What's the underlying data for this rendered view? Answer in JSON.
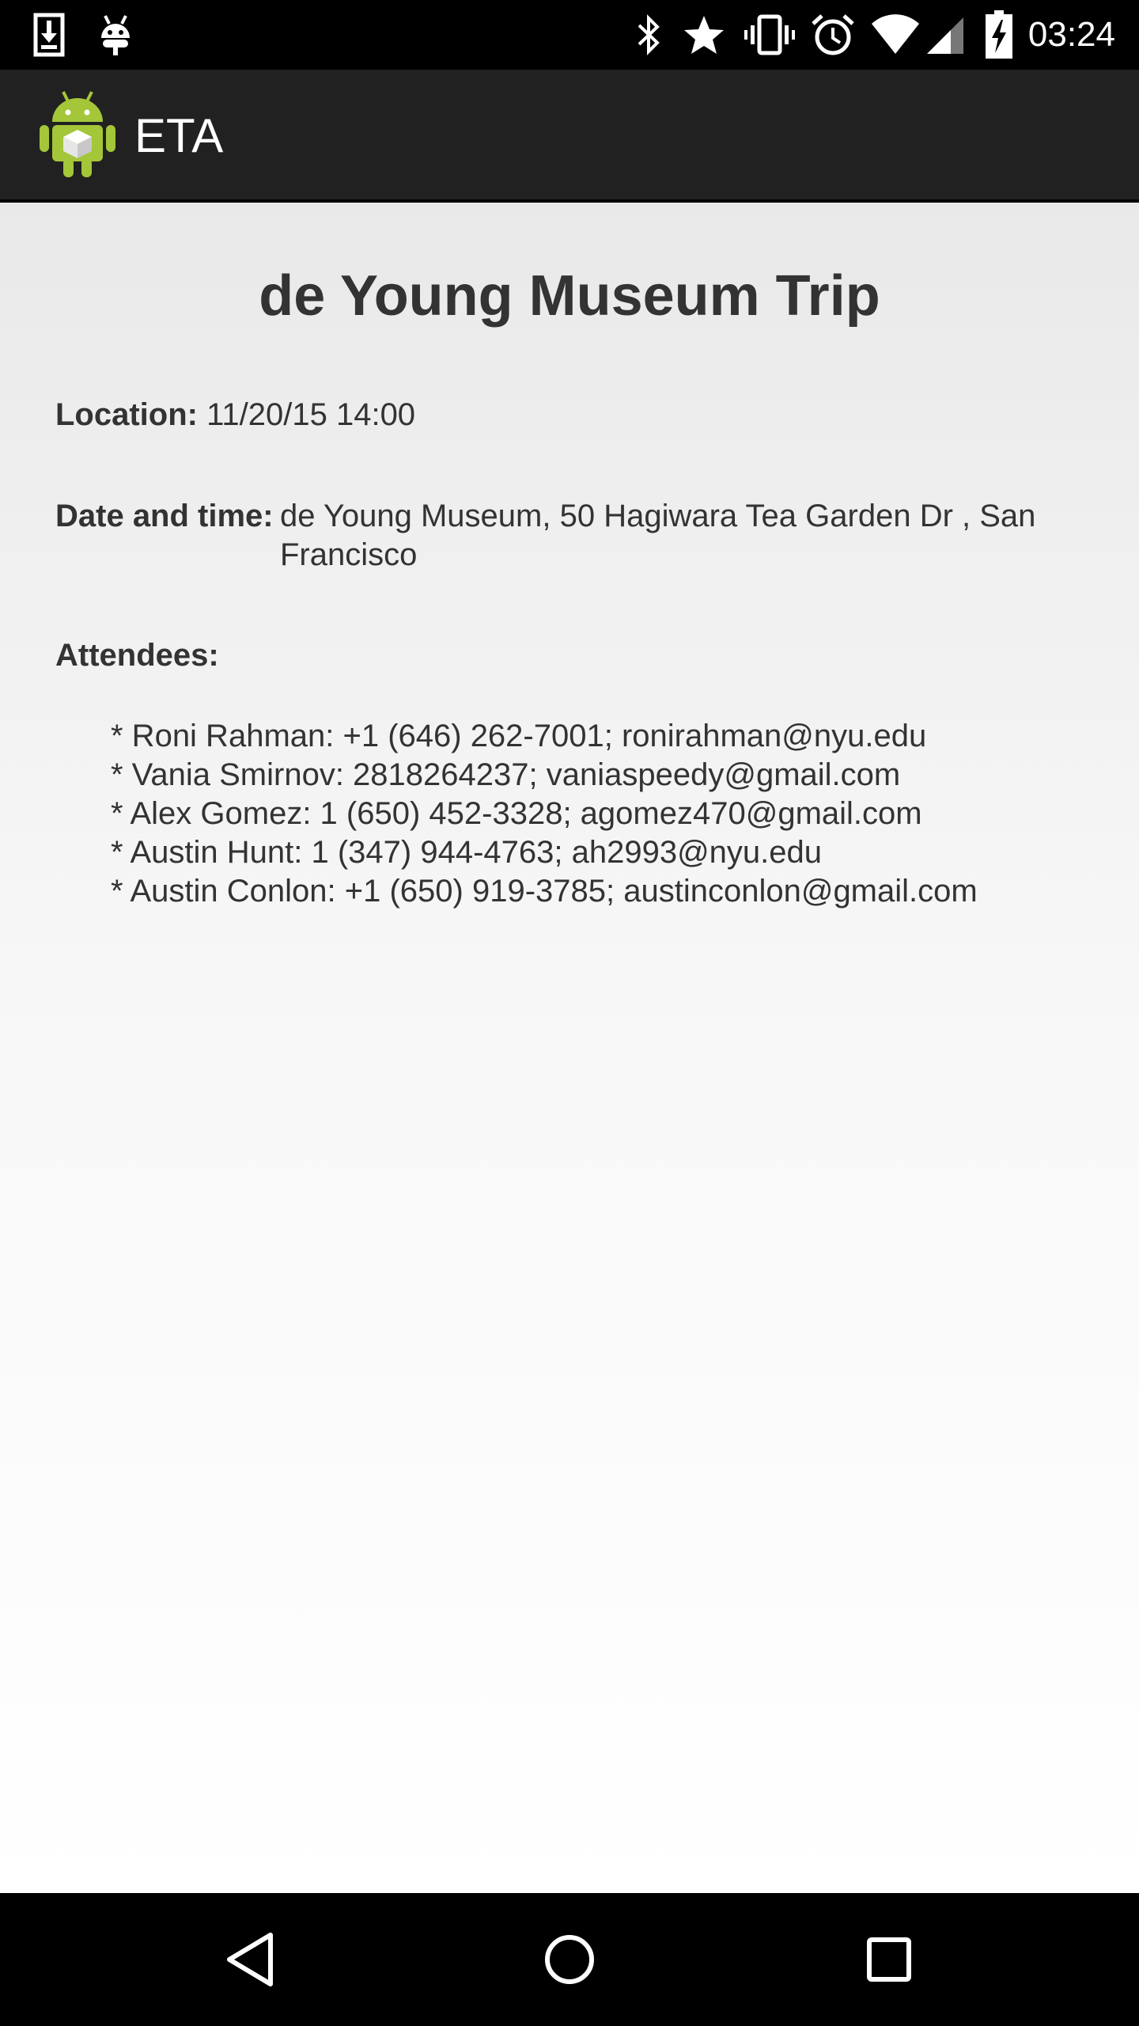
{
  "status_bar": {
    "time": "03:24",
    "icons": [
      "download-icon",
      "android-debug-icon",
      "bluetooth-icon",
      "star-icon",
      "vibrate-icon",
      "alarm-icon",
      "wifi-icon",
      "cell-signal-icon",
      "battery-charging-icon"
    ]
  },
  "action_bar": {
    "title": "ETA",
    "app_icon": "android-app-icon"
  },
  "event": {
    "title": "de Young Museum Trip",
    "location_label": "Location:",
    "location_value": "11/20/15 14:00",
    "datetime_label": "Date and time:",
    "datetime_value": "de Young Museum, 50 Hagiwara Tea Garden Dr , San Francisco",
    "attendees_label": "Attendees:",
    "attendees": [
      "* Roni Rahman: +1 (646) 262-7001; ronirahman@nyu.edu",
      "* Vania Smirnov: 2818264237; vaniaspeedy@gmail.com",
      "* Alex Gomez: 1 (650) 452-3328; agomez470@gmail.com",
      "* Austin Hunt: 1 (347) 944-4763; ah2993@nyu.edu",
      "* Austin Conlon: +1 (650) 919-3785; austinconlon@gmail.com"
    ]
  },
  "nav_bar": {
    "buttons": [
      "back-icon",
      "home-icon",
      "recents-icon"
    ]
  },
  "colors": {
    "status_bar_bg": "#000000",
    "action_bar_bg": "#212121",
    "text": "#333333",
    "nav_bar_bg": "#000000",
    "android_green": "#a4c639"
  }
}
